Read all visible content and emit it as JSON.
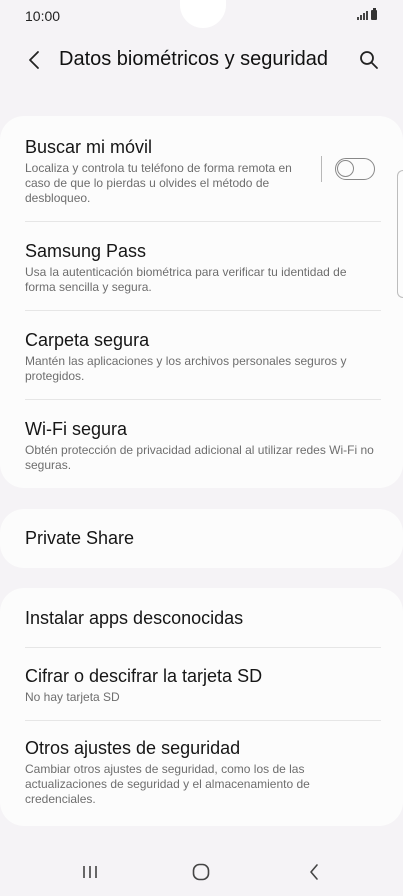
{
  "status_bar": {
    "time": "10:00"
  },
  "app_bar": {
    "title": "Datos biométricos y seguridad",
    "back_icon": "chevron-left-icon",
    "search_icon": "search-icon"
  },
  "card1": {
    "items": [
      {
        "title": "Buscar mi móvil",
        "subtitle": "Localiza y controla tu teléfono de forma remota en caso de que lo pierdas u olvides el método de desbloqueo.",
        "toggle_on": false
      },
      {
        "title": "Samsung Pass",
        "subtitle": "Usa la autenticación biométrica para verificar tu identidad de forma sencilla y segura."
      },
      {
        "title": "Carpeta segura",
        "subtitle": "Mantén las aplicaciones y los archivos personales seguros y protegidos."
      },
      {
        "title": "Wi-Fi segura",
        "subtitle": "Obtén protección de privacidad adicional al utilizar redes Wi-Fi no seguras."
      }
    ]
  },
  "card2": {
    "items": [
      {
        "title": "Private Share"
      }
    ]
  },
  "card3": {
    "items": [
      {
        "title": "Instalar apps desconocidas"
      },
      {
        "title": "Cifrar o descifrar la tarjeta SD",
        "subtitle": "No hay tarjeta SD"
      },
      {
        "title": "Otros ajustes de seguridad",
        "subtitle": "Cambiar otros ajustes de seguridad, como los de las actualizaciones de seguridad y el almacenamiento de credenciales."
      }
    ]
  },
  "nav_bar": {
    "recents_icon": "recents-icon",
    "home_icon": "home-icon",
    "back_icon": "back-icon"
  }
}
